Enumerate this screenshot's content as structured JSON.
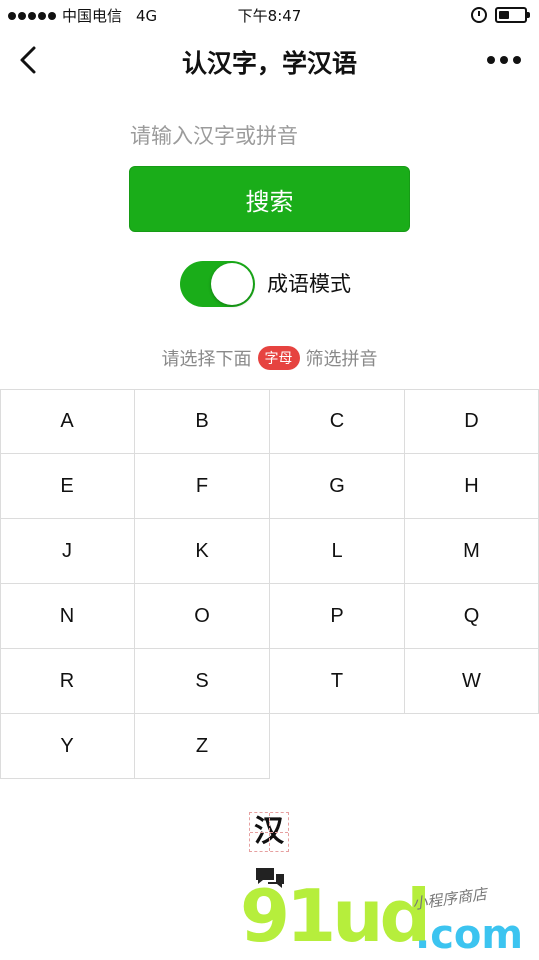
{
  "status_bar": {
    "carrier": "中国电信",
    "network": "4G",
    "time": "下午8:47",
    "battery_level": 0.45
  },
  "nav": {
    "title": "认汉字，学汉语"
  },
  "search": {
    "placeholder": "请输入汉字或拼音",
    "button_label": "搜索"
  },
  "mode_toggle": {
    "label": "成语模式",
    "on": true,
    "color": "#1aad19"
  },
  "hint": {
    "before": "请选择下面",
    "badge": "字母",
    "after": "筛选拼音",
    "badge_color": "#e64340"
  },
  "letters": [
    "A",
    "B",
    "C",
    "D",
    "E",
    "F",
    "G",
    "H",
    "J",
    "K",
    "L",
    "M",
    "N",
    "O",
    "P",
    "Q",
    "R",
    "S",
    "T",
    "W",
    "Y",
    "Z"
  ],
  "footer": {
    "logo_char": "汉"
  },
  "watermark": {
    "main": "91ud",
    "domain": ".com",
    "sub": "小程序商店"
  }
}
